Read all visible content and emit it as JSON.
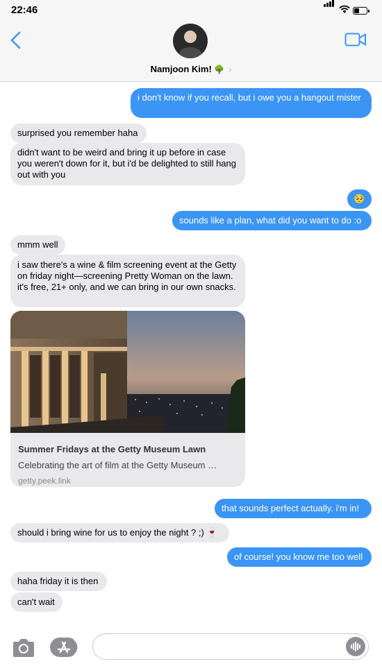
{
  "status": {
    "time": "22:46"
  },
  "contact": {
    "name": "Namjoon Kim!",
    "emoji": "🌳",
    "chevron": "›"
  },
  "messages": [
    {
      "dir": "out",
      "text": "i don't know if you recall, but i owe you a hangout mister"
    },
    {
      "dir": "in",
      "text": "surprised you remember haha"
    },
    {
      "dir": "in",
      "text": "didn't want to be weird and bring it up before in case you weren't down for it, but i'd be delighted to still hang out with you"
    },
    {
      "dir": "out",
      "text": "🥺"
    },
    {
      "dir": "out",
      "text": "sounds like a plan, what did you want to do :o"
    },
    {
      "dir": "in",
      "text": "mmm well"
    },
    {
      "dir": "in",
      "text": "i saw there's a wine & film screening event at the Getty on friday night—screening Pretty Woman on the lawn. it's free, 21+ only, and we can bring in our own snacks."
    },
    {
      "dir": "out",
      "text": "that sounds perfect actually. i'm in!"
    },
    {
      "dir": "in",
      "text": "should i bring wine for us to enjoy the night ? ;) 🍷"
    },
    {
      "dir": "out",
      "text": "of course! you know me too well"
    },
    {
      "dir": "in",
      "text": "haha friday it is then"
    },
    {
      "dir": "in",
      "text": "can't wait"
    }
  ],
  "link_preview": {
    "title": "Summer Fridays at the Getty Museum Lawn",
    "description": "Celebrating the art of film at the Getty Museum …",
    "url": "getty.peek.link"
  },
  "input": {
    "placeholder": ""
  },
  "icons": {
    "back": "chevron-left-icon",
    "video": "video-camera-icon",
    "camera": "camera-icon",
    "appstore": "app-store-icon",
    "audio": "audio-waveform-icon"
  },
  "colors": {
    "accent": "#3a95f5",
    "incoming": "#e9e9eb",
    "header": "#f6f6f6"
  }
}
